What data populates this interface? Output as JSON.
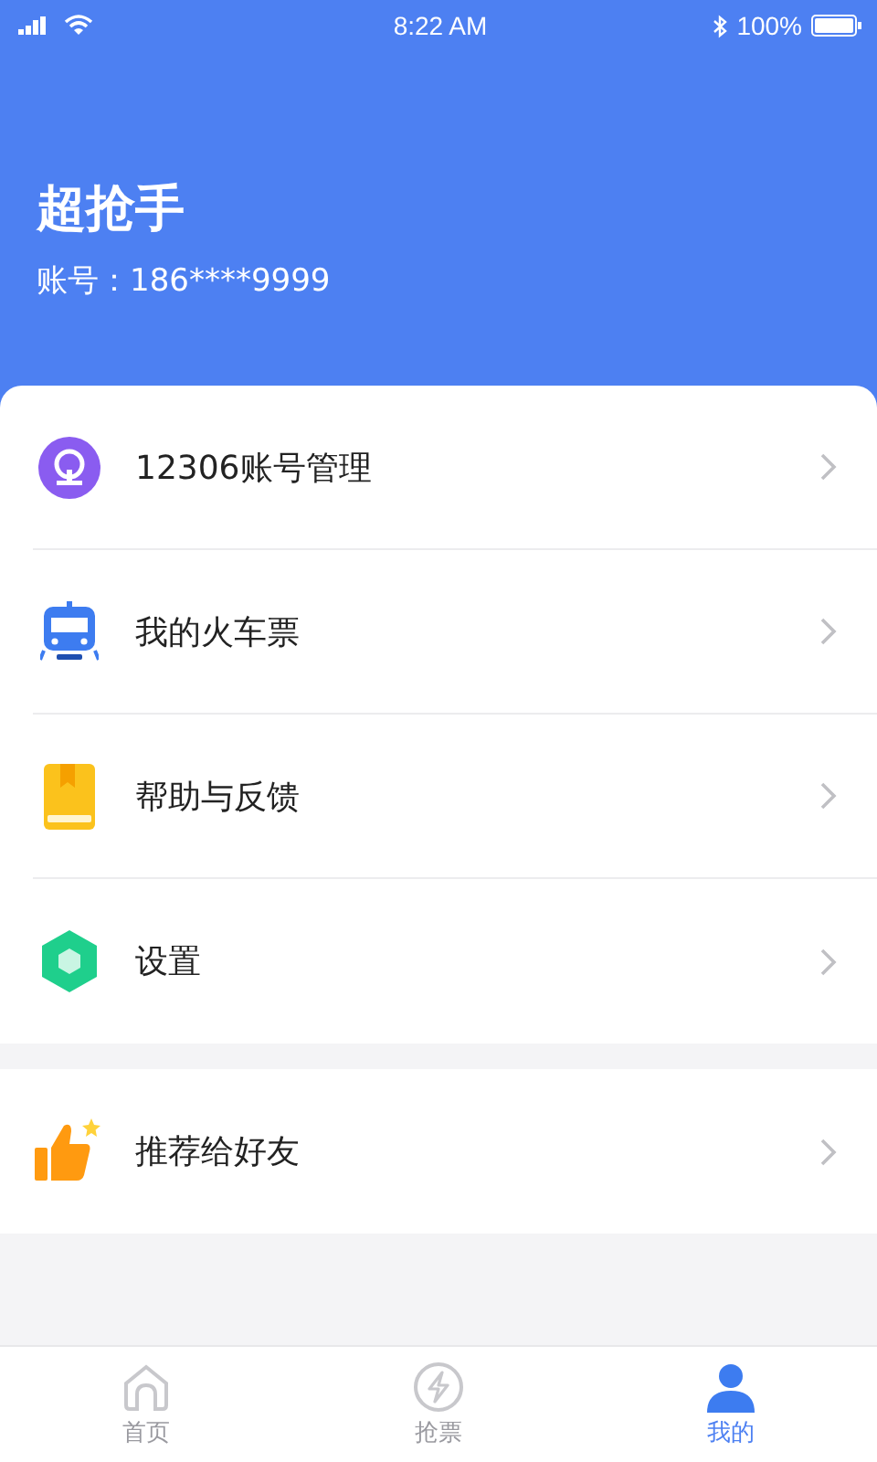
{
  "status_bar": {
    "time": "8:22 AM",
    "battery": "100%"
  },
  "profile": {
    "name": "超抢手",
    "account": "账号：186****9999"
  },
  "menu_groups": [
    {
      "items": [
        {
          "kind": "rail",
          "label": "12306账号管理"
        },
        {
          "kind": "train",
          "label": "我的火车票"
        },
        {
          "kind": "book",
          "label": "帮助与反馈"
        },
        {
          "kind": "hexagon",
          "label": "设置"
        }
      ]
    },
    {
      "items": [
        {
          "kind": "thumb",
          "label": "推荐给好友"
        }
      ]
    }
  ],
  "tabs": [
    {
      "kind": "home",
      "label": "首页",
      "selected": false
    },
    {
      "kind": "bolt",
      "label": "抢票",
      "selected": false
    },
    {
      "kind": "person",
      "label": "我的",
      "selected": true
    }
  ]
}
